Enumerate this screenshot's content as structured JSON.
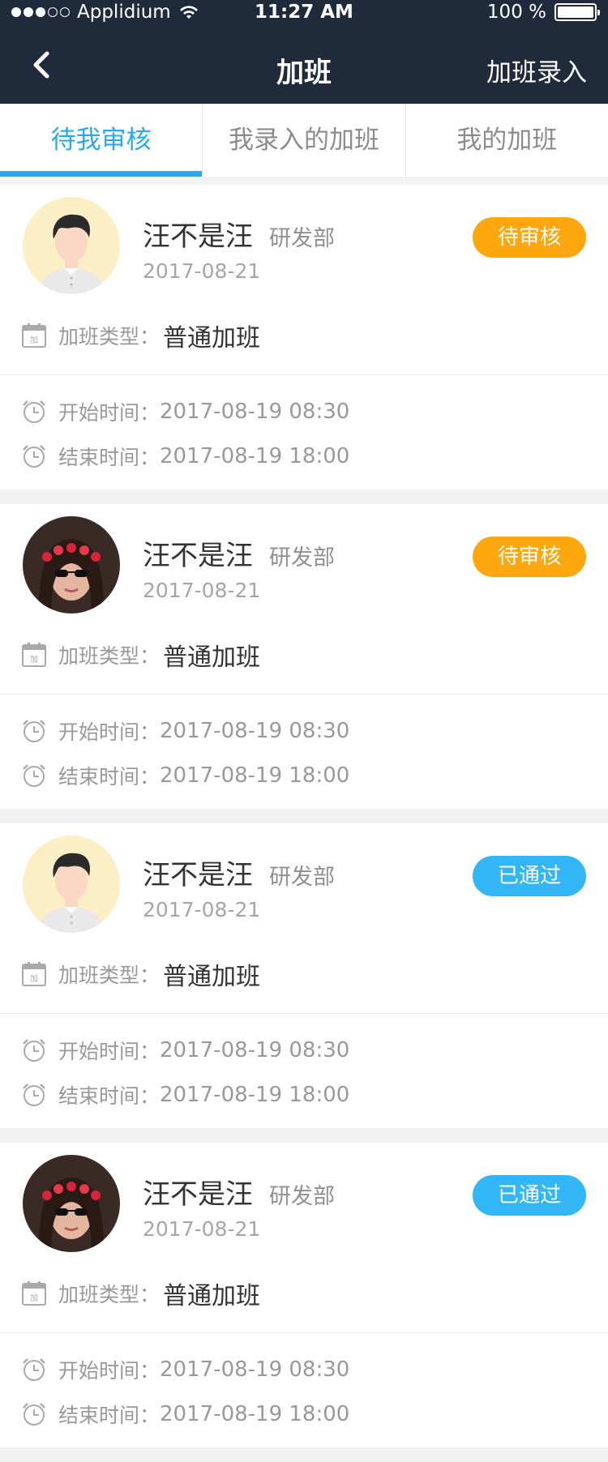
{
  "status_bar": {
    "carrier": "Applidium",
    "time": "11:27 AM",
    "battery": "100 %"
  },
  "nav": {
    "title": "加班",
    "action": "加班录入"
  },
  "tabs": [
    {
      "label": "待我审核",
      "active": true
    },
    {
      "label": "我录入的加班",
      "active": false
    },
    {
      "label": "我的加班",
      "active": false
    }
  ],
  "colors": {
    "pending": "#ffa70f",
    "approved": "#33b6f5",
    "accent": "#27a9ef",
    "header": "#1f2a3a"
  },
  "cards": [
    {
      "avatar": "cartoon-avatar-icon",
      "name": "汪不是汪",
      "dept": "研发部",
      "date": "2017-08-21",
      "status": "待审核",
      "status_type": "pending",
      "type_label": "加班类型：",
      "type_value": "普通加班",
      "start_label": "开始时间：",
      "start_value": "2017-08-19  08:30",
      "end_label": "结束时间：",
      "end_value": "2017-08-19  18:00"
    },
    {
      "avatar": "photo-avatar-icon",
      "name": "汪不是汪",
      "dept": "研发部",
      "date": "2017-08-21",
      "status": "待审核",
      "status_type": "pending",
      "type_label": "加班类型：",
      "type_value": "普通加班",
      "start_label": "开始时间：",
      "start_value": "2017-08-19  08:30",
      "end_label": "结束时间：",
      "end_value": "2017-08-19  18:00"
    },
    {
      "avatar": "cartoon-avatar-icon",
      "name": "汪不是汪",
      "dept": "研发部",
      "date": "2017-08-21",
      "status": "已通过",
      "status_type": "approved",
      "type_label": "加班类型：",
      "type_value": "普通加班",
      "start_label": "开始时间：",
      "start_value": "2017-08-19  08:30",
      "end_label": "结束时间：",
      "end_value": "2017-08-19  18:00"
    },
    {
      "avatar": "photo-avatar-icon",
      "name": "汪不是汪",
      "dept": "研发部",
      "date": "2017-08-21",
      "status": "已通过",
      "status_type": "approved",
      "type_label": "加班类型：",
      "type_value": "普通加班",
      "start_label": "开始时间：",
      "start_value": "2017-08-19  08:30",
      "end_label": "结束时间：",
      "end_value": "2017-08-19  18:00"
    }
  ]
}
